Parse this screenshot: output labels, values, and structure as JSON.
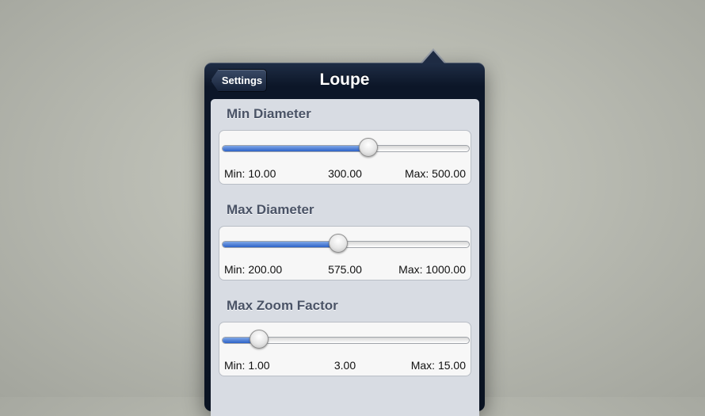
{
  "navbar": {
    "back_label": "Settings",
    "title": "Loupe"
  },
  "settings": [
    {
      "header": "Min Diameter",
      "min_label": "Min: 10.00",
      "value_label": "300.00",
      "max_label": "Max: 500.00",
      "fraction": 0.59
    },
    {
      "header": "Max Diameter",
      "min_label": "Min: 200.00",
      "value_label": "575.00",
      "max_label": "Max: 1000.00",
      "fraction": 0.47
    },
    {
      "header": "Max Zoom Factor",
      "min_label": "Min: 1.00",
      "value_label": "3.00",
      "max_label": "Max: 15.00",
      "fraction": 0.15
    }
  ],
  "colors": {
    "navbar": "#0c1628",
    "slider_fill": "#2c62c8",
    "content_bg": "#d8dce3"
  }
}
